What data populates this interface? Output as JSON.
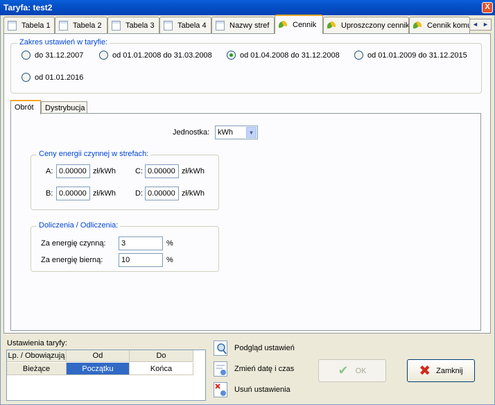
{
  "window": {
    "title": "Taryfa: test2",
    "close_glyph": "X"
  },
  "tabs": [
    {
      "label": "Tabela 1",
      "icon": "document-icon",
      "active": false
    },
    {
      "label": "Tabela 2",
      "icon": "document-icon",
      "active": false
    },
    {
      "label": "Tabela 3",
      "icon": "document-icon",
      "active": false
    },
    {
      "label": "Tabela 4",
      "icon": "document-icon",
      "active": false
    },
    {
      "label": "Nazwy stref",
      "icon": "document-icon",
      "active": false
    },
    {
      "label": "Cennik",
      "icon": "leaf-icon",
      "active": true
    },
    {
      "label": "Uproszczony cennik",
      "icon": "leaf-icon",
      "active": false
    },
    {
      "label": "Cennik komu",
      "icon": "leaf-icon",
      "active": false
    }
  ],
  "tab_scroll": {
    "left": "◄",
    "right": "►"
  },
  "range": {
    "legend": "Zakres ustawień w taryfie:",
    "options": [
      {
        "label": "do 31.12.2007",
        "selected": false
      },
      {
        "label": "od 01.01.2008 do 31.03.2008",
        "selected": false
      },
      {
        "label": "od 01.04.2008 do 31.12.2008",
        "selected": true
      },
      {
        "label": "od 01.01.2009 do 31.12.2015",
        "selected": false
      },
      {
        "label": "od 01.01.2016",
        "selected": false
      }
    ]
  },
  "inner_tabs": [
    {
      "label": "Obrót",
      "active": true
    },
    {
      "label": "Dystrybucja",
      "active": false
    }
  ],
  "unit": {
    "label": "Jednostka:",
    "value": "kWh"
  },
  "prices": {
    "legend": "Ceny energii czynnej w strefach:",
    "a": {
      "label": "A:",
      "value": "0.00000",
      "unit": "zł/kWh"
    },
    "b": {
      "label": "B:",
      "value": "0.00000",
      "unit": "zł/kWh"
    },
    "c": {
      "label": "C:",
      "value": "0.00000",
      "unit": "zł/kWh"
    },
    "d": {
      "label": "D:",
      "value": "0.00000",
      "unit": "zł/kWh"
    }
  },
  "surcharges": {
    "legend": "Doliczenia / Odliczenia:",
    "active": {
      "label": "Za energię czynną:",
      "value": "3",
      "unit": "%"
    },
    "reactive": {
      "label": "Za energię bierną:",
      "value": "10",
      "unit": "%"
    }
  },
  "settings": {
    "label": "Ustawienia taryfy:",
    "columns": [
      "Lp. / Obowiązują",
      "Od",
      "Do"
    ],
    "rows": [
      [
        "Bieżące",
        "Początku",
        "Końca"
      ]
    ]
  },
  "actions": {
    "preview": "Podgląd ustawień",
    "change_date": "Zmień datę i czas",
    "delete": "Usuń ustawienia"
  },
  "buttons": {
    "ok": "OK",
    "close": "Zamknij"
  },
  "colors": {
    "accent_tab": "#f8a727",
    "legend_text": "#0046d5",
    "selected_cell": "#316ac5",
    "titlebar": "#0550c8"
  }
}
